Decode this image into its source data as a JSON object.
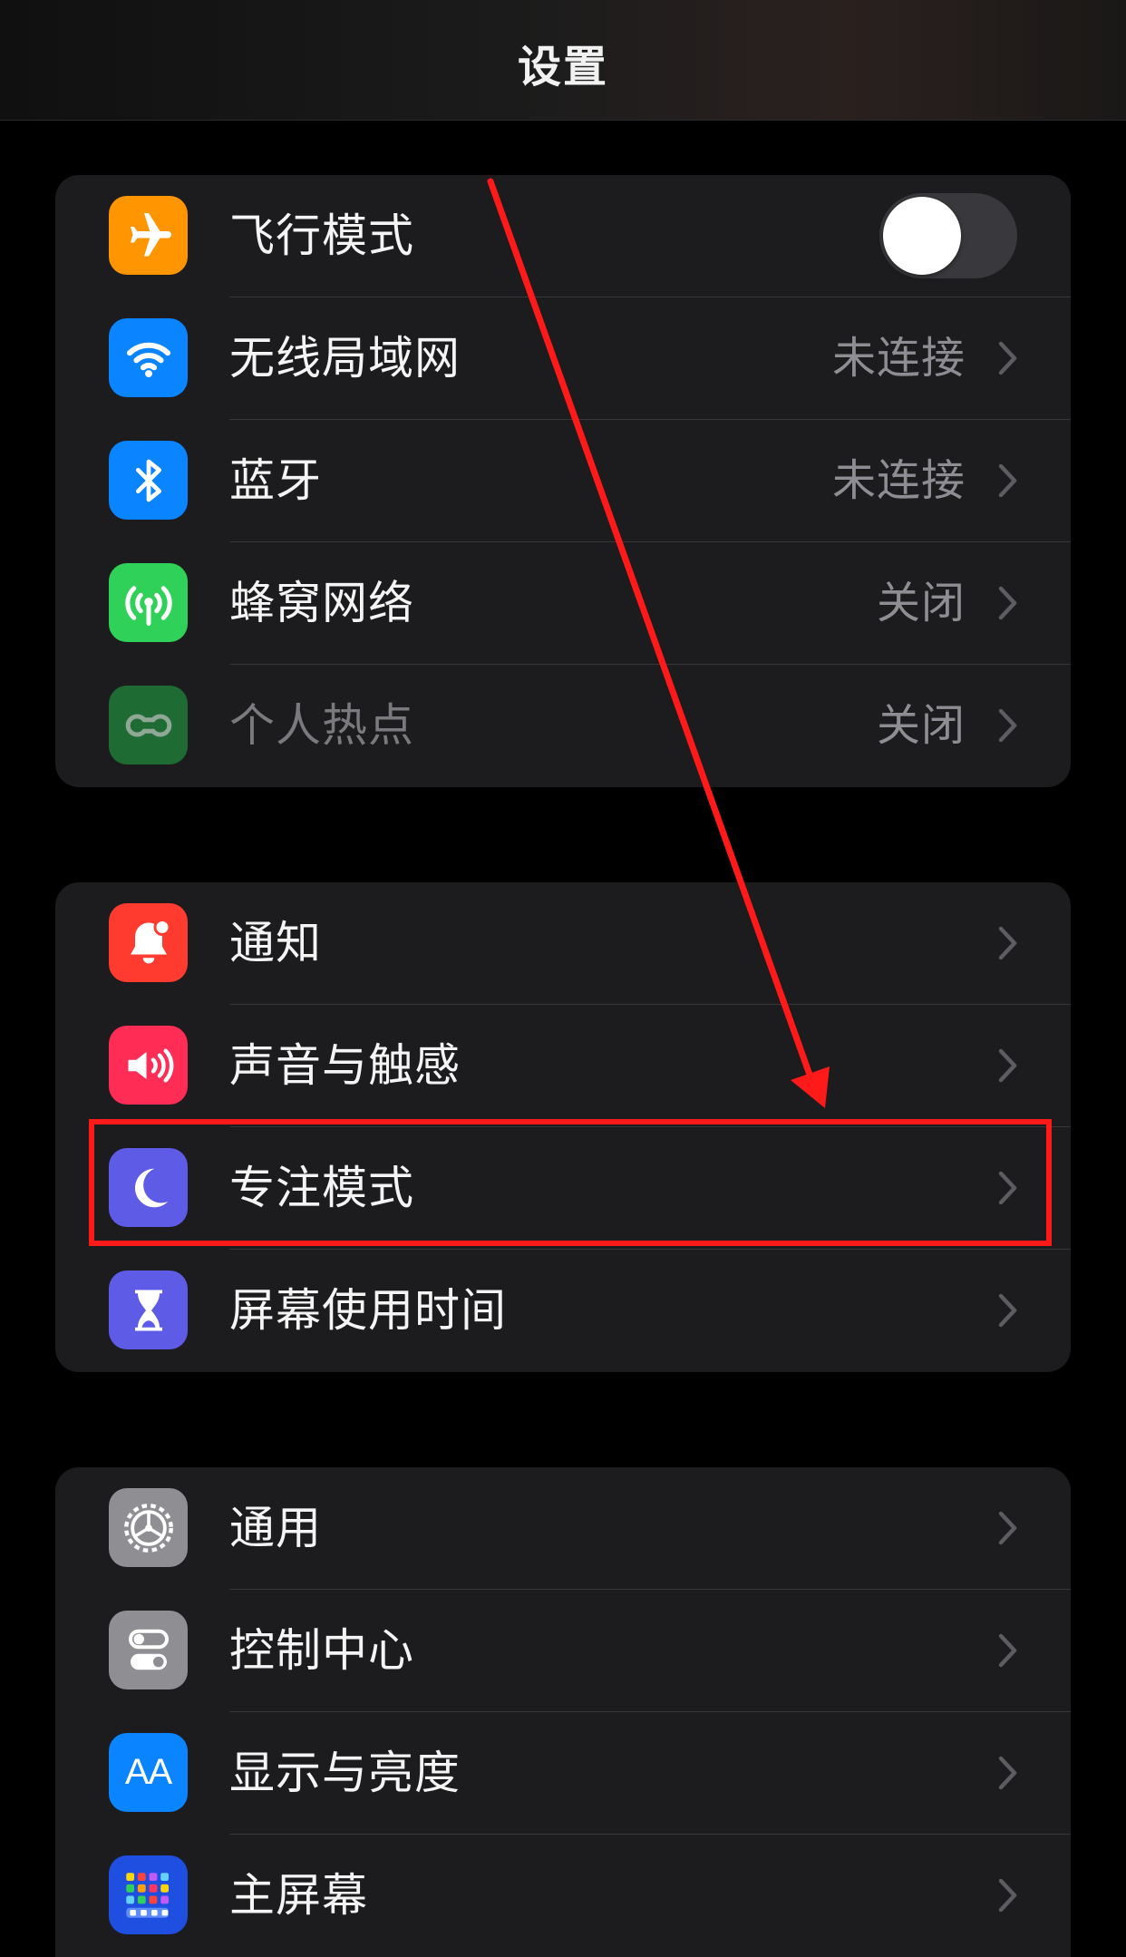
{
  "header": {
    "title": "设置"
  },
  "groups": [
    {
      "items": [
        {
          "label": "飞行模式",
          "icon": "airplane-icon",
          "color": "#ff9500",
          "toggle": "off"
        },
        {
          "label": "无线局域网",
          "icon": "wifi-icon",
          "color": "#0a84ff",
          "value": "未连接"
        },
        {
          "label": "蓝牙",
          "icon": "bluetooth-icon",
          "color": "#0a84ff",
          "value": "未连接"
        },
        {
          "label": "蜂窝网络",
          "icon": "cellular-antenna-icon",
          "color": "#30d158",
          "value": "关闭"
        },
        {
          "label": "个人热点",
          "icon": "hotspot-chain-icon",
          "color": "#1e6b34",
          "value": "关闭",
          "disabled": true
        }
      ]
    },
    {
      "items": [
        {
          "label": "通知",
          "icon": "bell-icon",
          "color": "#ff3b30"
        },
        {
          "label": "声音与触感",
          "icon": "speaker-icon",
          "color": "#ff2d55"
        },
        {
          "label": "专注模式",
          "icon": "moon-icon",
          "color": "#5e5ce6",
          "highlighted": true
        },
        {
          "label": "屏幕使用时间",
          "icon": "hourglass-icon",
          "color": "#5e5ce6"
        }
      ]
    },
    {
      "items": [
        {
          "label": "通用",
          "icon": "gear-icon",
          "color": "#8e8e93"
        },
        {
          "label": "控制中心",
          "icon": "switches-icon",
          "color": "#8e8e93"
        },
        {
          "label": "显示与亮度",
          "icon": "text-size-icon",
          "color": "#0a84ff",
          "icon_text": "AA"
        },
        {
          "label": "主屏幕",
          "icon": "app-grid-icon",
          "color": "#1f4fe0"
        }
      ]
    }
  ],
  "annotation": {
    "color": "#ff1a1a"
  }
}
